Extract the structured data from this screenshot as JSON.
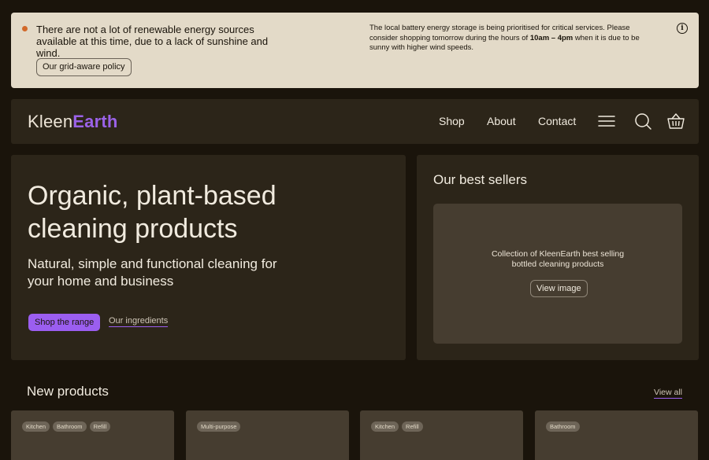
{
  "banner": {
    "message": "There are not a lot of renewable energy sources available at this time, due to a lack of sunshine and wind.",
    "policy_button": "Our grid-aware policy",
    "detail_before": "The local battery energy storage is being prioritised for critical services. Please consider shopping tomorrow during the hours of ",
    "detail_hours": "10am – 4pm",
    "detail_after": " when it is due to be sunny with higher wind speeds.",
    "info_glyph": "i",
    "status_color": "#d2692a"
  },
  "header": {
    "logo_part1": "Kleen",
    "logo_part2": "Earth",
    "nav": [
      "Shop",
      "About",
      "Contact"
    ],
    "icons": [
      "menu-icon",
      "search-icon",
      "basket-icon"
    ]
  },
  "hero": {
    "title": "Organic, plant-based cleaning products",
    "subtitle": "Natural, simple and functional cleaning for your home and business",
    "primary_button": "Shop the range",
    "secondary_link": "Our ingredients"
  },
  "best_sellers": {
    "title": "Our best sellers",
    "image_caption": "Collection of KleenEarth best selling bottled cleaning products",
    "view_button": "View image"
  },
  "new_products": {
    "title": "New products",
    "view_all": "View all",
    "cards": [
      {
        "tags": [
          "Kitchen",
          "Bathroom",
          "Refill"
        ]
      },
      {
        "tags": [
          "Multi-purpose"
        ]
      },
      {
        "tags": [
          "Kitchen",
          "Refill"
        ]
      },
      {
        "tags": [
          "Bathroom"
        ]
      }
    ]
  },
  "colors": {
    "accent": "#9b5ef0",
    "background": "#1a140b",
    "panel": "#2c2519",
    "banner_bg": "#e3dac8"
  }
}
